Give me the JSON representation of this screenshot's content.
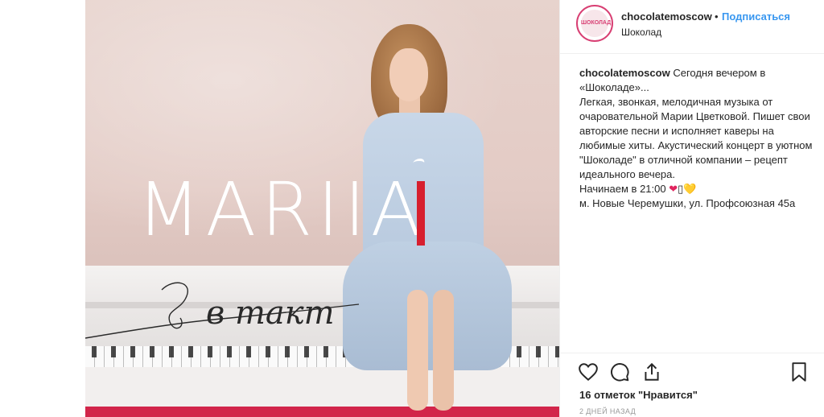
{
  "post": {
    "image": {
      "title": "MARIIA",
      "subtitle_script": "в такт"
    }
  },
  "header": {
    "avatar_text": "ШОКОЛАД",
    "username": "chocolatemoscow",
    "separator": "•",
    "follow_label": "Подписаться",
    "location": "Шоколад"
  },
  "caption": {
    "username": "chocolatemoscow",
    "line1": "Сегодня вечером в «Шоколаде»...",
    "line2": "Легкая, звонкая, мелодичная музыка от очаровательной Марии Цветковой. Пишет свои авторские песни и исполняет каверы на любимые хиты. Акустический концерт в уютном \"Шоколаде\" в отличной компании – рецепт идеального вечера.",
    "line3": "Начинаем в 21:00",
    "emoji_heart_red": "❤",
    "emoji_box": "▯",
    "emoji_heart_yellow": "💛",
    "line4": "м. Новые Черемушки, ул. Профсоюзная 45а"
  },
  "actions": {
    "icons": [
      "heart-icon",
      "comment-icon",
      "share-icon",
      "bookmark-icon"
    ]
  },
  "likes": "16 отметок \"Нравится\"",
  "time": "2 ДНЕЙ НАЗАД",
  "colors": {
    "accent_blue": "#3897f0",
    "brand_pink": "#d83f73",
    "title_red": "#d71f2e"
  }
}
